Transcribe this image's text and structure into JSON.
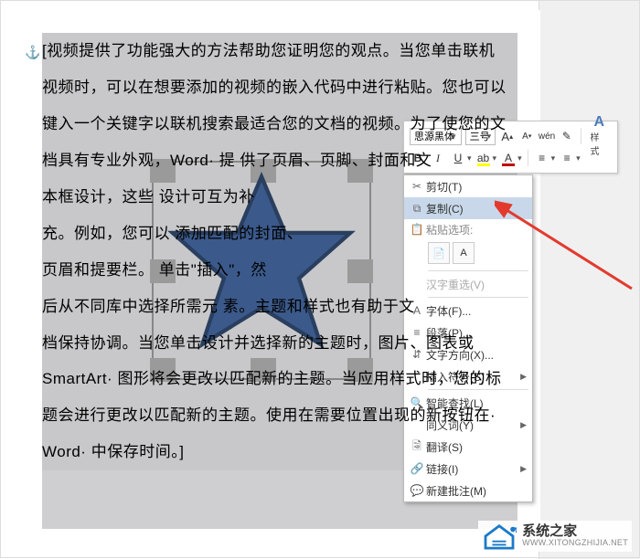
{
  "document": {
    "paragraphs": [
      "[视频提供了功能强大的方法帮助您证明您的观点。当您单击联机",
      "视频时，可以在想要添加的视频的嵌入代码中进行粘贴。您也可以",
      "键入一个关键字以联机搜索最适合您的文档的视频。为了使您的文",
      "档具有专业外观，Word· 提                 供了页眉、页脚、封面和文",
      "本框设计，这些                                                      设计可互为补",
      "充。例如，您可以                                                添加匹配的封面、",
      "页眉和提要栏。                                                     单击\"插入\"，然",
      "后从不同库中选择所需元                 素。主题和样式也有助于文",
      "档保持协调。当您单击设计并选择新的主题时，图片、图表或",
      "SmartArt· 图形将会更改以匹配新的主题。当应用样式时，您的标",
      "题会进行更改以匹配新的主题。使用在需要位置出现的新按钮在·",
      "Word· 中保存时间。]"
    ]
  },
  "toolbar": {
    "font_name": "思源黑体",
    "font_size": "三号",
    "grow_font": "A",
    "shrink_font": "A",
    "format_painter": "wén",
    "styles_label": "样式",
    "bold": "B",
    "italic": "I",
    "underline": "U",
    "font_color_letter": "A"
  },
  "context_menu": {
    "cut": "剪切(T)",
    "copy": "复制(C)",
    "paste_options": "粘贴选项:",
    "chinese_reselect": "汉字重选(V)",
    "font": "字体(F)...",
    "paragraph": "段落(P)...",
    "text_direction": "文字方向(X)...",
    "insert_symbol": "插入符号(S)",
    "smart_lookup": "智能查找(L)",
    "synonyms": "同义词(Y)",
    "translate": "翻译(S)",
    "hyperlink": "链接(I)",
    "new_comment": "新建批注(M)"
  },
  "watermark": {
    "title": "系统之家",
    "url": "WWW.XITONGZHIJIA.NET"
  },
  "colors": {
    "star_fill": "#3b5a8b",
    "star_stroke": "#2a3f5f",
    "highlight_row": "#c8d8ea",
    "arrow": "#e33a2e"
  }
}
